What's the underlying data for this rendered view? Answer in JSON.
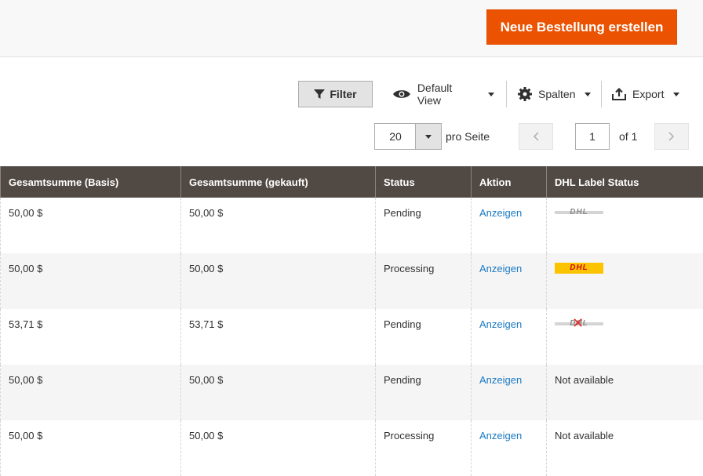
{
  "header": {
    "create_order_label": "Neue Bestellung erstellen"
  },
  "toolbar": {
    "filter_label": "Filter",
    "view_label": "Default View",
    "columns_label": "Spalten",
    "export_label": "Export"
  },
  "pager": {
    "per_page_value": "20",
    "per_page_label": "pro Seite",
    "current_page": "1",
    "of_label": "of 1"
  },
  "table": {
    "columns": [
      "Gesamtsumme (Basis)",
      "Gesamtsumme (gekauft)",
      "Status",
      "Aktion",
      "DHL Label Status"
    ],
    "rows": [
      {
        "base": "50,00 $",
        "purchased": "50,00 $",
        "status": "Pending",
        "action": "Anzeigen",
        "dhl": "grey",
        "dhl_text": ""
      },
      {
        "base": "50,00 $",
        "purchased": "50,00 $",
        "status": "Processing",
        "action": "Anzeigen",
        "dhl": "color",
        "dhl_text": ""
      },
      {
        "base": "53,71 $",
        "purchased": "53,71 $",
        "status": "Pending",
        "action": "Anzeigen",
        "dhl": "error",
        "dhl_text": ""
      },
      {
        "base": "50,00 $",
        "purchased": "50,00 $",
        "status": "Pending",
        "action": "Anzeigen",
        "dhl": "none",
        "dhl_text": "Not available"
      },
      {
        "base": "50,00 $",
        "purchased": "50,00 $",
        "status": "Processing",
        "action": "Anzeigen",
        "dhl": "none",
        "dhl_text": "Not available"
      }
    ]
  },
  "colors": {
    "accent": "#eb5202",
    "header_bg": "#514943",
    "link": "#1979c3"
  }
}
